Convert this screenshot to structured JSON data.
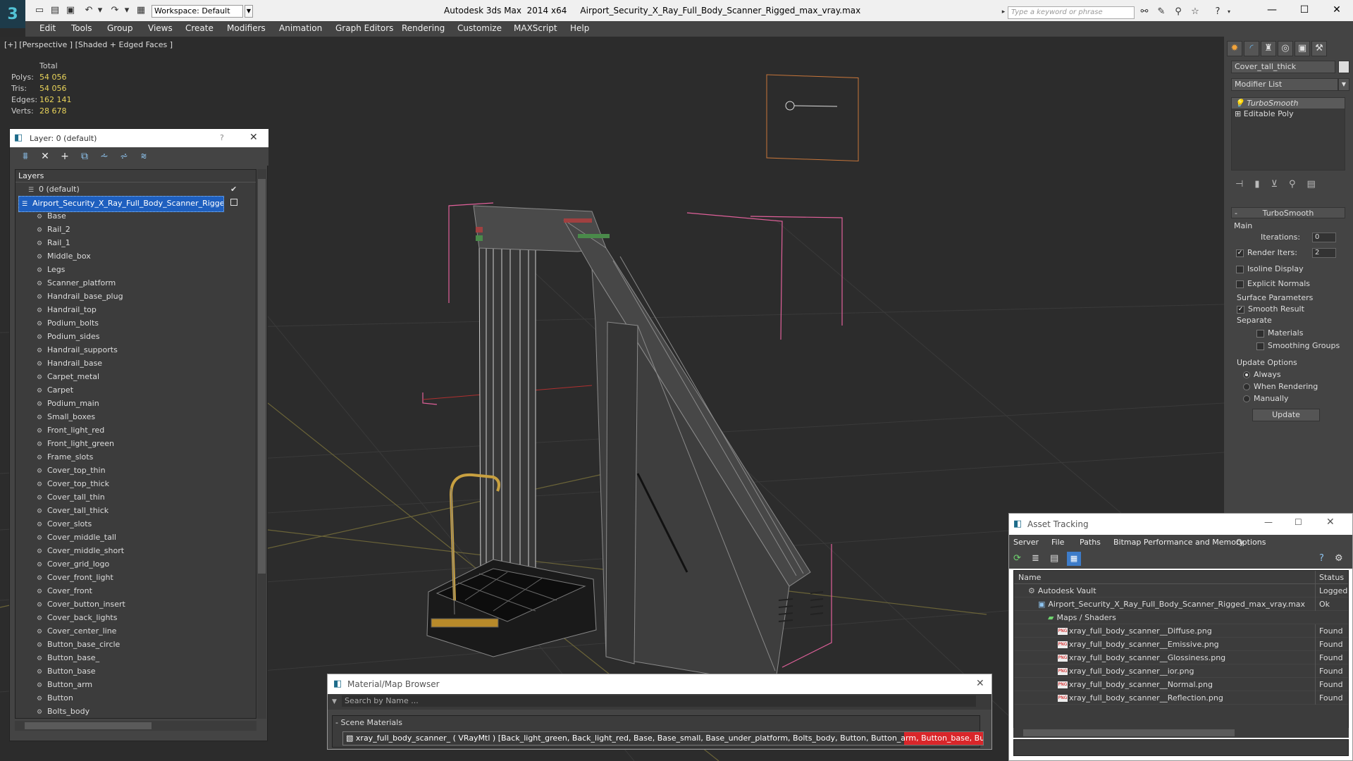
{
  "app": {
    "title": "Autodesk 3ds Max  2014 x64     Airport_Security_X_Ray_Full_Body_Scanner_Rigged_max_vray.max",
    "workspace": "Workspace: Default",
    "search_placeholder": "Type a keyword or phrase"
  },
  "menu": [
    "Edit",
    "Tools",
    "Group",
    "Views",
    "Create",
    "Modifiers",
    "Animation",
    "Graph Editors",
    "Rendering",
    "Customize",
    "MAXScript",
    "Help"
  ],
  "viewport": {
    "label": "[+] [Perspective ] [Shaded + Edged Faces ]",
    "stats": {
      "header": "Total",
      "polys_label": "Polys:",
      "polys": "54 056",
      "tris_label": "Tris:",
      "tris": "54 056",
      "edges_label": "Edges:",
      "edges": "162 141",
      "verts_label": "Verts:",
      "verts": "28 678"
    }
  },
  "command_panel": {
    "object_name": "Cover_tall_thick",
    "modifier_list": "Modifier List",
    "stack": [
      "TurboSmooth",
      "Editable Poly"
    ],
    "rollout_title": "TurboSmooth",
    "main": "Main",
    "iterations_label": "Iterations:",
    "iterations": "0",
    "render_iters_label": "Render Iters:",
    "render_iters": "2",
    "isoline": "Isoline Display",
    "explicit_normals": "Explicit Normals",
    "surface_params": "Surface Parameters",
    "smooth_result": "Smooth Result",
    "separate": "Separate",
    "materials": "Materials",
    "smoothing_groups": "Smoothing Groups",
    "update_options": "Update Options",
    "always": "Always",
    "when_rendering": "When Rendering",
    "manually": "Manually",
    "update_button": "Update"
  },
  "layer_panel": {
    "title": "Layer: 0 (default)",
    "help": "?",
    "list_header": "Layers",
    "default_layer": "0 (default)",
    "selected_layer": "Airport_Security_X_Ray_Full_Body_Scanner_Rigged",
    "objects": [
      "Base",
      "Rail_2",
      "Rail_1",
      "Middle_box",
      "Legs",
      "Scanner_platform",
      "Handrail_base_plug",
      "Handrail_top",
      "Podium_bolts",
      "Podium_sides",
      "Handrail_supports",
      "Handrail_base",
      "Carpet_metal",
      "Carpet",
      "Podium_main",
      "Small_boxes",
      "Front_light_red",
      "Front_light_green",
      "Frame_slots",
      "Cover_top_thin",
      "Cover_top_thick",
      "Cover_tall_thin",
      "Cover_tall_thick",
      "Cover_slots",
      "Cover_middle_tall",
      "Cover_middle_short",
      "Cover_grid_logo",
      "Cover_front_light",
      "Cover_front",
      "Cover_button_insert",
      "Cover_back_lights",
      "Cover_center_line",
      "Button_base_circle",
      "Button_base_",
      "Button_base",
      "Button_arm",
      "Button",
      "Bolts_body"
    ]
  },
  "asset_tracking": {
    "title": "Asset Tracking",
    "menu": [
      "Server",
      "File",
      "Paths",
      "Bitmap Performance and Memory",
      "Options"
    ],
    "col_name": "Name",
    "col_status": "Status",
    "rows": [
      {
        "name": "Autodesk Vault",
        "status": "Logged",
        "indent": 1,
        "kind": "vault"
      },
      {
        "name": "Airport_Security_X_Ray_Full_Body_Scanner_Rigged_max_vray.max",
        "status": "Ok",
        "indent": 2,
        "kind": "max"
      },
      {
        "name": "Maps / Shaders",
        "status": "",
        "indent": 3,
        "kind": "folder"
      },
      {
        "name": "xray_full_body_scanner__Diffuse.png",
        "status": "Found",
        "indent": 4,
        "kind": "png"
      },
      {
        "name": "xray_full_body_scanner__Emissive.png",
        "status": "Found",
        "indent": 4,
        "kind": "png"
      },
      {
        "name": "xray_full_body_scanner__Glossiness.png",
        "status": "Found",
        "indent": 4,
        "kind": "png"
      },
      {
        "name": "xray_full_body_scanner__ior.png",
        "status": "Found",
        "indent": 4,
        "kind": "png"
      },
      {
        "name": "xray_full_body_scanner__Normal.png",
        "status": "Found",
        "indent": 4,
        "kind": "png"
      },
      {
        "name": "xray_full_body_scanner__Reflection.png",
        "status": "Found",
        "indent": 4,
        "kind": "png"
      }
    ]
  },
  "material_browser": {
    "title": "Material/Map Browser",
    "search_placeholder": "Search by Name ...",
    "group": "Scene Materials",
    "item": "xray_full_body_scanner_ ( VRayMtl ) [Back_light_green, Back_light_red, Base, Base_small, Base_under_platform, Bolts_body, Button, Button_arm, Button_base, Button_bas..."
  },
  "colors": {
    "accent": "#3399ff",
    "selection": "#1e5fbf",
    "stats_value": "#e8d35a",
    "material_red": "#d9262a"
  }
}
